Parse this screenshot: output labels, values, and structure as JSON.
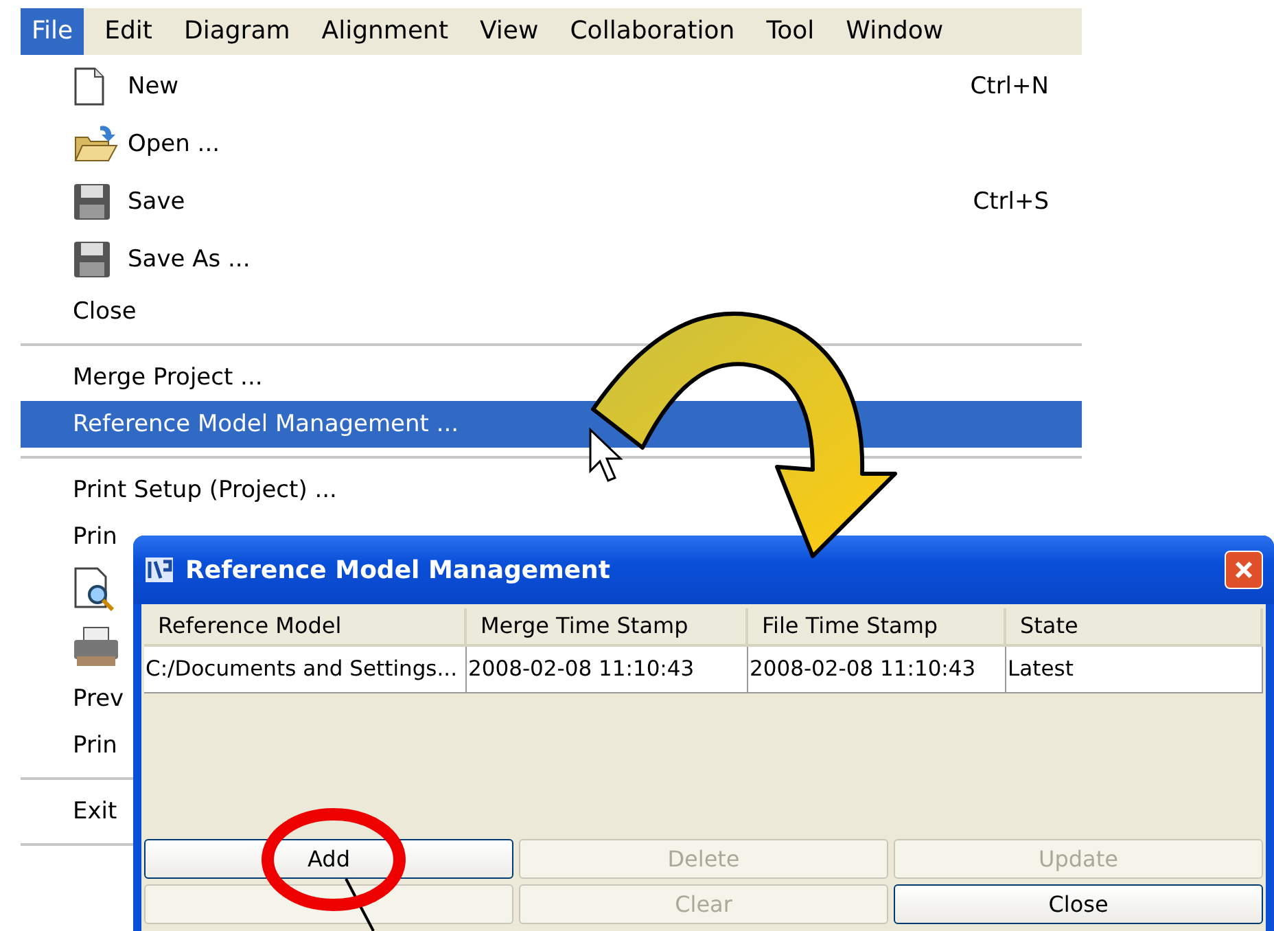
{
  "menubar": [
    {
      "label": "File",
      "selected": true
    },
    {
      "label": "Edit",
      "selected": false
    },
    {
      "label": "Diagram",
      "selected": false
    },
    {
      "label": "Alignment",
      "selected": false
    },
    {
      "label": "View",
      "selected": false
    },
    {
      "label": "Collaboration",
      "selected": false
    },
    {
      "label": "Tool",
      "selected": false
    },
    {
      "label": "Window",
      "selected": false
    }
  ],
  "file_menu": [
    {
      "kind": "icon-item",
      "label": "New",
      "shortcut": "Ctrl+N",
      "selected": false
    },
    {
      "kind": "icon-item",
      "label": "Open ...",
      "selected": false
    },
    {
      "kind": "icon-item",
      "label": "Save",
      "shortcut": "Ctrl+S",
      "selected": false
    },
    {
      "kind": "icon-item",
      "label": "Save As ...",
      "selected": false
    },
    {
      "kind": "item",
      "label": "Close",
      "selected": false
    },
    {
      "kind": "separator"
    },
    {
      "kind": "item",
      "label": "Merge Project ...",
      "selected": false
    },
    {
      "kind": "item",
      "label": "Reference Model Management ...",
      "selected": true
    },
    {
      "kind": "separator"
    },
    {
      "kind": "item",
      "label": "Print Setup (Project) ...",
      "selected": false
    },
    {
      "kind": "item",
      "label": "Prin",
      "selected": false
    },
    {
      "kind": "icon-item",
      "selected": false
    },
    {
      "kind": "icon-item",
      "selected": false
    },
    {
      "kind": "item",
      "label": "Prev",
      "selected": false
    },
    {
      "kind": "item",
      "label": "Prin",
      "selected": false
    },
    {
      "kind": "separator"
    },
    {
      "kind": "item",
      "label": "Exit",
      "selected": false
    },
    {
      "kind": "separator"
    }
  ],
  "dialog": {
    "title": "Reference Model Management",
    "table": {
      "columns": [
        "Reference Model",
        "Merge Time Stamp",
        "File Time Stamp",
        "State"
      ],
      "rows": [
        [
          "C:/Documents and Settings...",
          "2008-02-08 11:10:43",
          "2008-02-08 11:10:43",
          "Latest"
        ]
      ]
    },
    "buttons": [
      {
        "label": "Add",
        "disabled": false
      },
      {
        "label": "Delete",
        "disabled": true
      },
      {
        "label": "Update",
        "disabled": true
      },
      {
        "disabled": true
      },
      {
        "label": "Clear",
        "disabled": true
      },
      {
        "label": "Close",
        "disabled": false
      }
    ]
  }
}
